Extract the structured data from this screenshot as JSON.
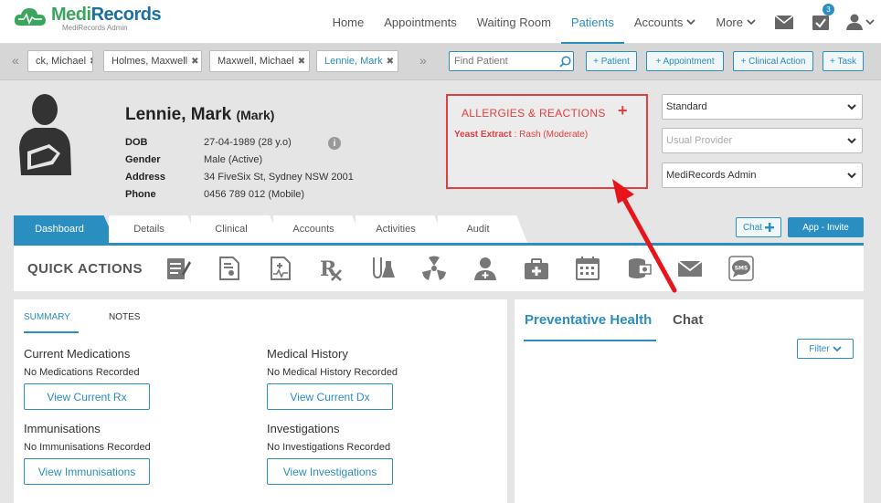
{
  "app": {
    "brand_medi": "Medi",
    "brand_records": "Records",
    "brand_sub": "MediRecords Admin"
  },
  "nav": {
    "items": [
      {
        "label": "Home"
      },
      {
        "label": "Appointments"
      },
      {
        "label": "Waiting Room"
      },
      {
        "label": "Patients"
      },
      {
        "label": "Accounts"
      },
      {
        "label": "More"
      }
    ],
    "task_count": "3"
  },
  "patient_tabs": {
    "tabs": [
      {
        "label": "ck, Michael"
      },
      {
        "label": "Holmes, Maxwell"
      },
      {
        "label": "Maxwell, Michael"
      },
      {
        "label": "Lennie, Mark"
      }
    ],
    "find_placeholder": "Find Patient",
    "buttons": [
      "+ Patient",
      "+ Appointment",
      "+ Clinical Action",
      "+ Task"
    ]
  },
  "patient": {
    "name": "Lennie, Mark",
    "nickname": "(Mark)",
    "fields": [
      {
        "label": "DOB",
        "value": "27-04-1989 (28 y.o)"
      },
      {
        "label": "Gender",
        "value": "Male (Active)"
      },
      {
        "label": "Address",
        "value": "34 FiveSix St, Sydney NSW 2001"
      },
      {
        "label": "Phone",
        "value": "0456 789 012 (Mobile)"
      }
    ],
    "info_glyph": "i"
  },
  "allergies": {
    "title": "ALLERGIES & REACTIONS",
    "add_glyph": "+",
    "items": [
      {
        "substance": "Yeast Extract",
        "reaction": " : Rash (Moderate)"
      }
    ]
  },
  "selects": {
    "billing": "Standard",
    "provider_placeholder": "Usual Provider",
    "practice": "MediRecords Admin"
  },
  "main_tabs": {
    "tabs": [
      "Dashboard",
      "Details",
      "Clinical",
      "Accounts",
      "Activities",
      "Audit"
    ],
    "chat_label": "Chat",
    "invite_label": "App - Invite"
  },
  "quick_actions": {
    "title": "QUICK ACTIONS",
    "icons": [
      "notes-icon",
      "certificate-icon",
      "report-icon",
      "prescription-icon",
      "pathology-icon",
      "radiology-icon",
      "referral-icon",
      "medical-kit-icon",
      "calendar-icon",
      "billing-icon",
      "email-icon",
      "sms-icon"
    ]
  },
  "summary": {
    "tabs": [
      "SUMMARY",
      "NOTES"
    ],
    "sections": [
      {
        "title": "Current Medications",
        "value": "No Medications Recorded",
        "button": "View Current Rx"
      },
      {
        "title": "Medical History",
        "value": "No Medical History Recorded",
        "button": "View Current Dx"
      },
      {
        "title": "Immunisations",
        "value": "No Immunisations Recorded",
        "button": "View Immunisations"
      },
      {
        "title": "Investigations",
        "value": "No Investigations Recorded",
        "button": "View Investigations"
      }
    ]
  },
  "right_panel": {
    "tabs": [
      "Preventative Health",
      "Chat"
    ],
    "filter_label": "Filter"
  },
  "colors": {
    "accent": "#2a8ec0",
    "alert": "#e04040",
    "brand_green": "#3aa55d",
    "brand_blue": "#1a6fa3"
  }
}
